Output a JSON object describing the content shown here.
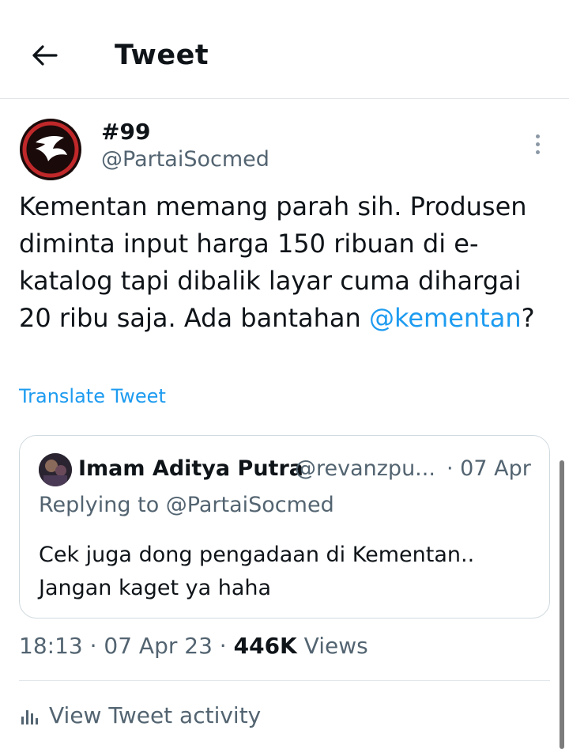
{
  "header": {
    "title": "Tweet",
    "back_icon": "arrow-left-icon"
  },
  "tweet": {
    "display_name": "#99",
    "handle": "@PartaiSocmed",
    "text_before": "Kementan memang parah sih. Produsen diminta input harga 150 ribuan di e-katalog tapi dibalik layar cuma dihargai 20 ribu saja. Ada bantahan ",
    "mention": "@kementan",
    "text_after": "?",
    "translate_label": "Translate Tweet",
    "time": "18:13",
    "date": "07 Apr 23",
    "views_count": "446K",
    "views_label": "Views"
  },
  "quote": {
    "display_name": "Imam Aditya Putra",
    "handle": "@revanzpu...",
    "date": "· 07 Apr",
    "replying_to": "Replying to @PartaiSocmed",
    "text": "Cek juga dong pengadaan di Kementan.. Jangan kaget ya haha"
  },
  "activity": {
    "label": "View Tweet activity"
  },
  "colors": {
    "link": "#1d9bf0",
    "secondary": "#536471",
    "primary": "#0f1419"
  }
}
